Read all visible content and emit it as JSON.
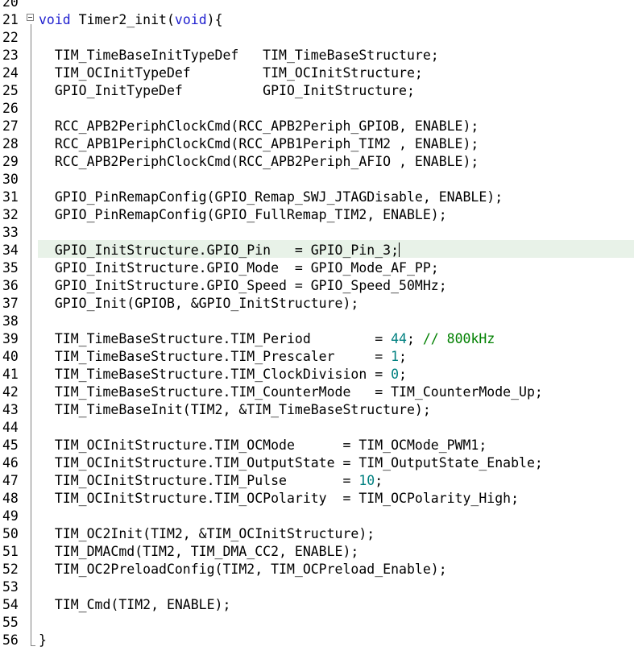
{
  "editor": {
    "lines": [
      {
        "n": "20",
        "segs": []
      },
      {
        "n": "21",
        "segs": [
          {
            "t": "void",
            "c": "kw"
          },
          {
            "t": " Timer2_init(",
            "c": ""
          },
          {
            "t": "void",
            "c": "kw"
          },
          {
            "t": "){",
            "c": ""
          }
        ]
      },
      {
        "n": "22",
        "segs": []
      },
      {
        "n": "23",
        "segs": [
          {
            "t": "  TIM_TimeBaseInitTypeDef   TIM_TimeBaseStructure;",
            "c": ""
          }
        ]
      },
      {
        "n": "24",
        "segs": [
          {
            "t": "  TIM_OCInitTypeDef         TIM_OCInitStructure;",
            "c": ""
          }
        ]
      },
      {
        "n": "25",
        "segs": [
          {
            "t": "  GPIO_InitTypeDef          GPIO_InitStructure;",
            "c": ""
          }
        ]
      },
      {
        "n": "26",
        "segs": []
      },
      {
        "n": "27",
        "segs": [
          {
            "t": "  RCC_APB2PeriphClockCmd(RCC_APB2Periph_GPIOB, ENABLE);",
            "c": ""
          }
        ]
      },
      {
        "n": "28",
        "segs": [
          {
            "t": "  RCC_APB1PeriphClockCmd(RCC_APB1Periph_TIM2 , ENABLE);",
            "c": ""
          }
        ]
      },
      {
        "n": "29",
        "segs": [
          {
            "t": "  RCC_APB2PeriphClockCmd(RCC_APB2Periph_AFIO , ENABLE);",
            "c": ""
          }
        ]
      },
      {
        "n": "30",
        "segs": []
      },
      {
        "n": "31",
        "segs": [
          {
            "t": "  GPIO_PinRemapConfig(GPIO_Remap_SWJ_JTAGDisable, ENABLE);",
            "c": ""
          }
        ]
      },
      {
        "n": "32",
        "segs": [
          {
            "t": "  GPIO_PinRemapConfig(GPIO_FullRemap_TIM2, ENABLE);",
            "c": ""
          }
        ]
      },
      {
        "n": "33",
        "segs": []
      },
      {
        "n": "34",
        "segs": [
          {
            "t": "  GPIO_InitStructure.GPIO_Pin   = GPIO_Pin_3;",
            "c": ""
          }
        ],
        "current": true
      },
      {
        "n": "35",
        "segs": [
          {
            "t": "  GPIO_InitStructure.GPIO_Mode  = GPIO_Mode_AF_PP;",
            "c": ""
          }
        ]
      },
      {
        "n": "36",
        "segs": [
          {
            "t": "  GPIO_InitStructure.GPIO_Speed = GPIO_Speed_50MHz;",
            "c": ""
          }
        ]
      },
      {
        "n": "37",
        "segs": [
          {
            "t": "  GPIO_Init(GPIOB, &GPIO_InitStructure);",
            "c": ""
          }
        ]
      },
      {
        "n": "38",
        "segs": []
      },
      {
        "n": "39",
        "segs": [
          {
            "t": "  TIM_TimeBaseStructure.TIM_Period        = ",
            "c": ""
          },
          {
            "t": "44",
            "c": "num"
          },
          {
            "t": "; ",
            "c": ""
          },
          {
            "t": "// 800kHz",
            "c": "cm"
          }
        ]
      },
      {
        "n": "40",
        "segs": [
          {
            "t": "  TIM_TimeBaseStructure.TIM_Prescaler     = ",
            "c": ""
          },
          {
            "t": "1",
            "c": "num"
          },
          {
            "t": ";",
            "c": ""
          }
        ]
      },
      {
        "n": "41",
        "segs": [
          {
            "t": "  TIM_TimeBaseStructure.TIM_ClockDivision = ",
            "c": ""
          },
          {
            "t": "0",
            "c": "num"
          },
          {
            "t": ";",
            "c": ""
          }
        ]
      },
      {
        "n": "42",
        "segs": [
          {
            "t": "  TIM_TimeBaseStructure.TIM_CounterMode   = TIM_CounterMode_Up;",
            "c": ""
          }
        ]
      },
      {
        "n": "43",
        "segs": [
          {
            "t": "  TIM_TimeBaseInit(TIM2, &TIM_TimeBaseStructure);",
            "c": ""
          }
        ]
      },
      {
        "n": "44",
        "segs": []
      },
      {
        "n": "45",
        "segs": [
          {
            "t": "  TIM_OCInitStructure.TIM_OCMode      = TIM_OCMode_PWM1;",
            "c": ""
          }
        ]
      },
      {
        "n": "46",
        "segs": [
          {
            "t": "  TIM_OCInitStructure.TIM_OutputState = TIM_OutputState_Enable;",
            "c": ""
          }
        ]
      },
      {
        "n": "47",
        "segs": [
          {
            "t": "  TIM_OCInitStructure.TIM_Pulse       = ",
            "c": ""
          },
          {
            "t": "10",
            "c": "num"
          },
          {
            "t": ";",
            "c": ""
          }
        ]
      },
      {
        "n": "48",
        "segs": [
          {
            "t": "  TIM_OCInitStructure.TIM_OCPolarity  = TIM_OCPolarity_High;",
            "c": ""
          }
        ]
      },
      {
        "n": "49",
        "segs": []
      },
      {
        "n": "50",
        "segs": [
          {
            "t": "  TIM_OC2Init(TIM2, &TIM_OCInitStructure);",
            "c": ""
          }
        ]
      },
      {
        "n": "51",
        "segs": [
          {
            "t": "  TIM_DMACmd(TIM2, TIM_DMA_CC2, ENABLE);",
            "c": ""
          }
        ]
      },
      {
        "n": "52",
        "segs": [
          {
            "t": "  TIM_OC2PreloadConfig(TIM2, TIM_OCPreload_Enable);",
            "c": ""
          }
        ]
      },
      {
        "n": "53",
        "segs": []
      },
      {
        "n": "54",
        "segs": [
          {
            "t": "  TIM_Cmd(TIM2, ENABLE);",
            "c": ""
          }
        ]
      },
      {
        "n": "55",
        "segs": []
      },
      {
        "n": "56",
        "segs": [
          {
            "t": "}",
            "c": ""
          }
        ]
      }
    ],
    "colors": {
      "keyword": "#1f1fcf",
      "number": "#008080",
      "comment": "#008000",
      "current_line": "#e8f2e8",
      "fold_marker": "#808080"
    },
    "icons": {
      "fold": "fold-collapse-icon",
      "caret": "text-caret"
    }
  }
}
